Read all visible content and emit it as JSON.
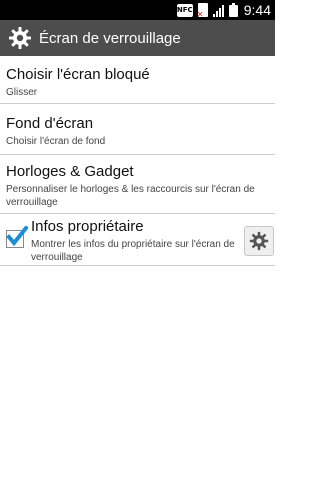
{
  "status_bar": {
    "nfc_label": "NFC",
    "time": "9:44",
    "icons": [
      "nfc-icon",
      "sim-card-missing-icon",
      "signal-icon",
      "battery-icon"
    ]
  },
  "header": {
    "title": "Écran de verrouillage",
    "icon": "gear-icon"
  },
  "settings": {
    "items": [
      {
        "label": "Choisir l'écran bloqué",
        "summary": "Glisser"
      },
      {
        "label": "Fond d'écran",
        "summary": "Choisir l'écran de fond"
      },
      {
        "label": "Horloges & Gadget",
        "summary": "Personnaliser le horloges & les raccourcis sur l'écran de verrouillage"
      },
      {
        "label": "Infos propriétaire",
        "summary": "Montrer les infos du propriétaire sur l'écran de verrouillage",
        "checked": true,
        "action_icon": "gear-icon"
      }
    ]
  },
  "colors": {
    "header_bg": "#4d4d4d",
    "status_bar_bg": "#000000",
    "check_blue": "#1a8fd6"
  }
}
